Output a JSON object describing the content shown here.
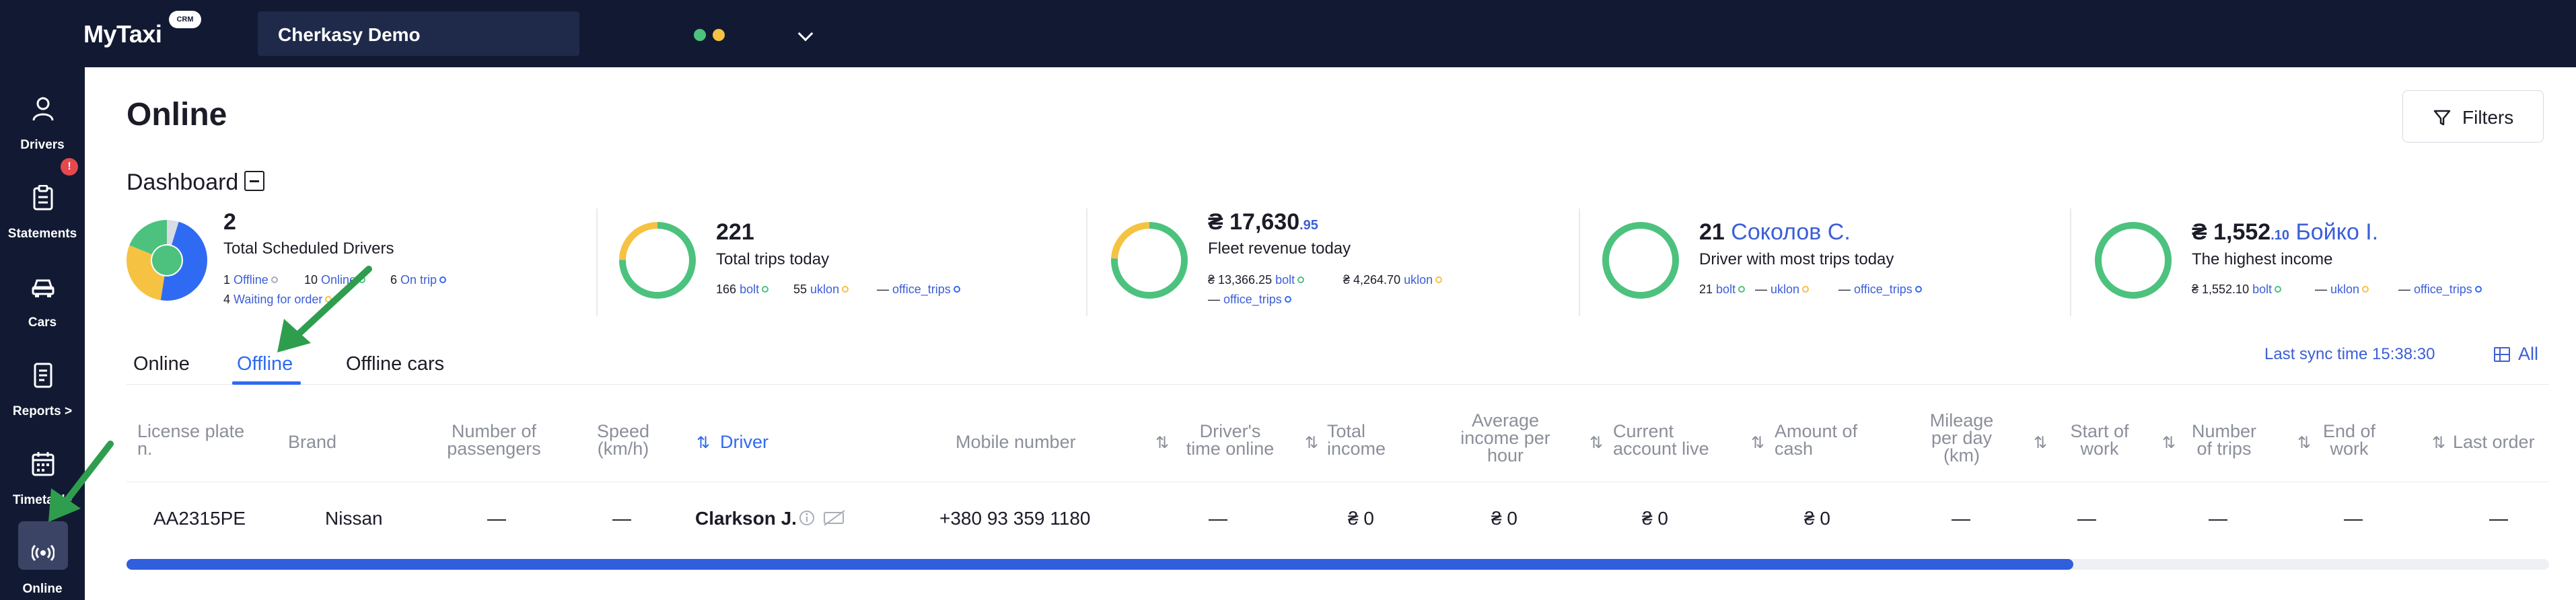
{
  "app": {
    "logo": "MyTaxi",
    "logo_badge": "CRM"
  },
  "org_select": {
    "value": "Cherkasy Demo",
    "badge_green": "●",
    "badge_yellow": "●"
  },
  "sidebar": {
    "items": [
      {
        "label": "Drivers",
        "icon": "user-icon"
      },
      {
        "label": "Statements",
        "icon": "clipboard-icon",
        "badge": "!"
      },
      {
        "label": "Cars",
        "icon": "car-icon"
      },
      {
        "label": "Reports >",
        "icon": "report-icon"
      },
      {
        "label": "Timetable",
        "icon": "calendar-icon"
      },
      {
        "label": "Online",
        "icon": "broadcast-icon",
        "active": true
      }
    ]
  },
  "page": {
    "title": "Online",
    "filters_label": "Filters"
  },
  "dashboard": {
    "title": "Dashboard",
    "cards": [
      {
        "value": "2",
        "label": "Total Scheduled Drivers",
        "legend": [
          {
            "count": "1",
            "text": "Offline"
          },
          {
            "count": "10",
            "text": "Online"
          },
          {
            "count": "6",
            "text": "On trip"
          },
          {
            "count": "4",
            "text": "Waiting for order"
          }
        ],
        "donut": [
          {
            "name": "Offline",
            "value": 1,
            "color": "#d9dce3"
          },
          {
            "name": "Online",
            "value": 10,
            "color": "#2f6bf2"
          },
          {
            "name": "On trip",
            "value": 6,
            "color": "#f5c242"
          },
          {
            "name": "Waiting for order",
            "value": 4,
            "color": "#4cc27e"
          }
        ]
      },
      {
        "value": "221",
        "label": "Total trips today",
        "legend": [
          {
            "count": "166",
            "text": "bolt"
          },
          {
            "count": "55",
            "text": "uklon"
          },
          {
            "count": "—",
            "text": "office_trips"
          }
        ],
        "donut": [
          {
            "name": "bolt",
            "value": 166,
            "color": "#4cc27e"
          },
          {
            "name": "uklon",
            "value": 55,
            "color": "#f5c242"
          }
        ]
      },
      {
        "value": "₴ 17,630",
        "decimals": ".95",
        "label": "Fleet revenue today",
        "legend": [
          {
            "count": "₴ 13,366.25",
            "text": "bolt"
          },
          {
            "count": "₴ 4,264.70",
            "text": "uklon"
          },
          {
            "count": "—",
            "text": "office_trips"
          }
        ],
        "donut": [
          {
            "name": "bolt",
            "value": 13366.25,
            "color": "#4cc27e"
          },
          {
            "name": "uklon",
            "value": 4264.7,
            "color": "#f5c242"
          }
        ]
      },
      {
        "value": "21",
        "name": "Соколов С.",
        "label": "Driver with most trips today",
        "legend": [
          {
            "count": "21",
            "text": "bolt"
          },
          {
            "count": "—",
            "text": "uklon"
          },
          {
            "count": "—",
            "text": "office_trips"
          }
        ],
        "donut": [
          {
            "name": "bolt",
            "value": 21,
            "color": "#4cc27e"
          }
        ]
      },
      {
        "value": "₴ 1,552",
        "decimals": ".10",
        "name": "Бойко І.",
        "label": "The highest income",
        "legend": [
          {
            "count": "₴ 1,552.10",
            "text": "bolt"
          },
          {
            "count": "—",
            "text": "uklon"
          },
          {
            "count": "—",
            "text": "office_trips"
          }
        ],
        "donut": [
          {
            "name": "bolt",
            "value": 1552.1,
            "color": "#4cc27e"
          }
        ]
      }
    ]
  },
  "tabs": [
    {
      "label": "Online"
    },
    {
      "label": "Offline",
      "active": true
    },
    {
      "label": "Offline cars"
    }
  ],
  "sync": {
    "text": "Last sync time 15:38:30"
  },
  "columns_button": {
    "label": "All"
  },
  "table": {
    "headers": {
      "license_plate": [
        "License plate",
        "n."
      ],
      "brand": [
        "Brand"
      ],
      "passengers": [
        "Number of",
        "passengers"
      ],
      "speed": [
        "Speed",
        "(km/h)"
      ],
      "driver": [
        "Driver"
      ],
      "mobile": [
        "Mobile number"
      ],
      "time_online": [
        "Driver's",
        "time online"
      ],
      "total_income": [
        "Total",
        "income"
      ],
      "avg_income": [
        "Average",
        "income per",
        "hour"
      ],
      "account": [
        "Current",
        "account live"
      ],
      "cash": [
        "Amount of",
        "cash"
      ],
      "mileage": [
        "Mileage",
        "per day",
        "(km)"
      ],
      "start": [
        "Start of",
        "work"
      ],
      "trips": [
        "Number",
        "of trips"
      ],
      "end": [
        "End of",
        "work"
      ],
      "last_order": [
        "Last order"
      ]
    },
    "rows": [
      {
        "license_plate": "AA2315PE",
        "brand": "Nissan",
        "passengers": "—",
        "speed": "—",
        "driver": "Clarkson J.",
        "mobile": "+380 93 359 1180",
        "time_online": "—",
        "total_income": "₴ 0",
        "avg_income": "₴ 0",
        "account": "₴ 0",
        "cash": "₴ 0",
        "mileage": "—",
        "start": "—",
        "trips": "—",
        "end": "—",
        "last_order": "—"
      }
    ]
  },
  "scrollbar": {
    "position_fraction": 0.8
  },
  "colors": {
    "accent": "#2f6bf2",
    "sidebar": "#121a33",
    "green": "#4cc27e",
    "yellow": "#f5c242",
    "arrow": "#2e9e4e"
  }
}
